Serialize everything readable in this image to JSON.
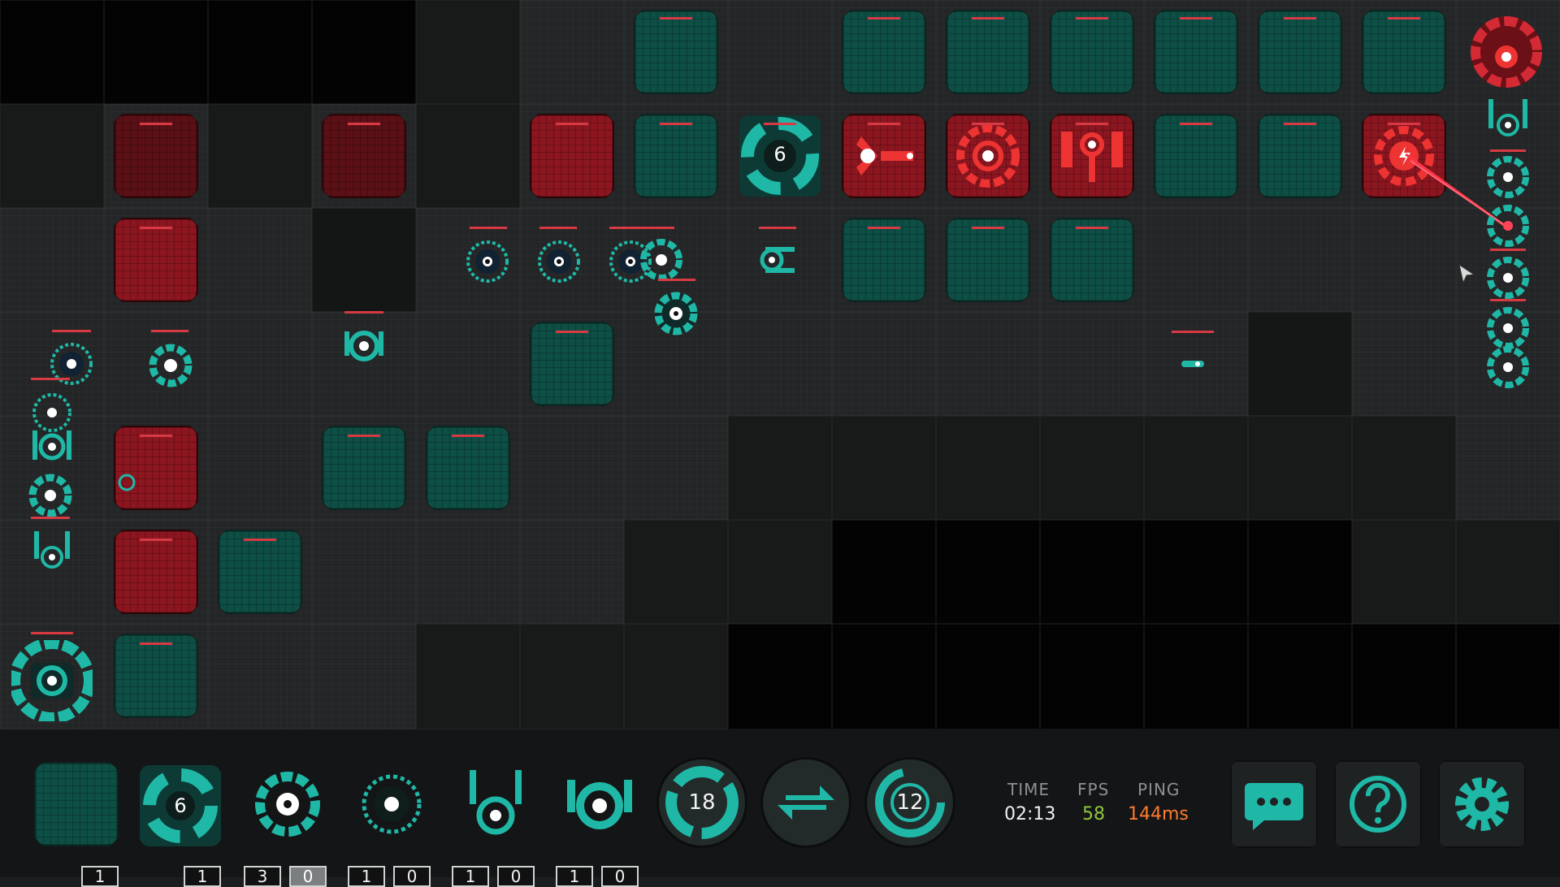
{
  "colors": {
    "ally": "#1fb8a6",
    "ally_block": "#0d4e45",
    "enemy": "#d42a36",
    "enemy_block": "#5a1016",
    "fps_color": "#8fc63f",
    "ping_color": "#ff7a30"
  },
  "board": {
    "selected_unit_badge": "6"
  },
  "inventory": [
    {
      "name": "block",
      "counts": [
        "1"
      ]
    },
    {
      "name": "nova-turret",
      "counts": [
        "1"
      ]
    },
    {
      "name": "core-turret",
      "counts": [
        "3",
        "0"
      ]
    },
    {
      "name": "saw-turret",
      "counts": [
        "1",
        "0"
      ]
    },
    {
      "name": "rail-turret",
      "counts": [
        "1",
        "0"
      ]
    },
    {
      "name": "shield-turret",
      "counts": [
        "1",
        "0"
      ]
    }
  ],
  "round_buttons": {
    "left_value": "18",
    "middle_icon": "swap-icon",
    "right_value": "12"
  },
  "stats": {
    "time_label": "TIME",
    "time_value": "02:13",
    "fps_label": "FPS",
    "fps_value": "58",
    "ping_label": "PING",
    "ping_value": "144ms"
  },
  "buttons": {
    "chat_icon": "chat-icon",
    "help_icon": "help-icon",
    "settings_icon": "gear-icon"
  }
}
